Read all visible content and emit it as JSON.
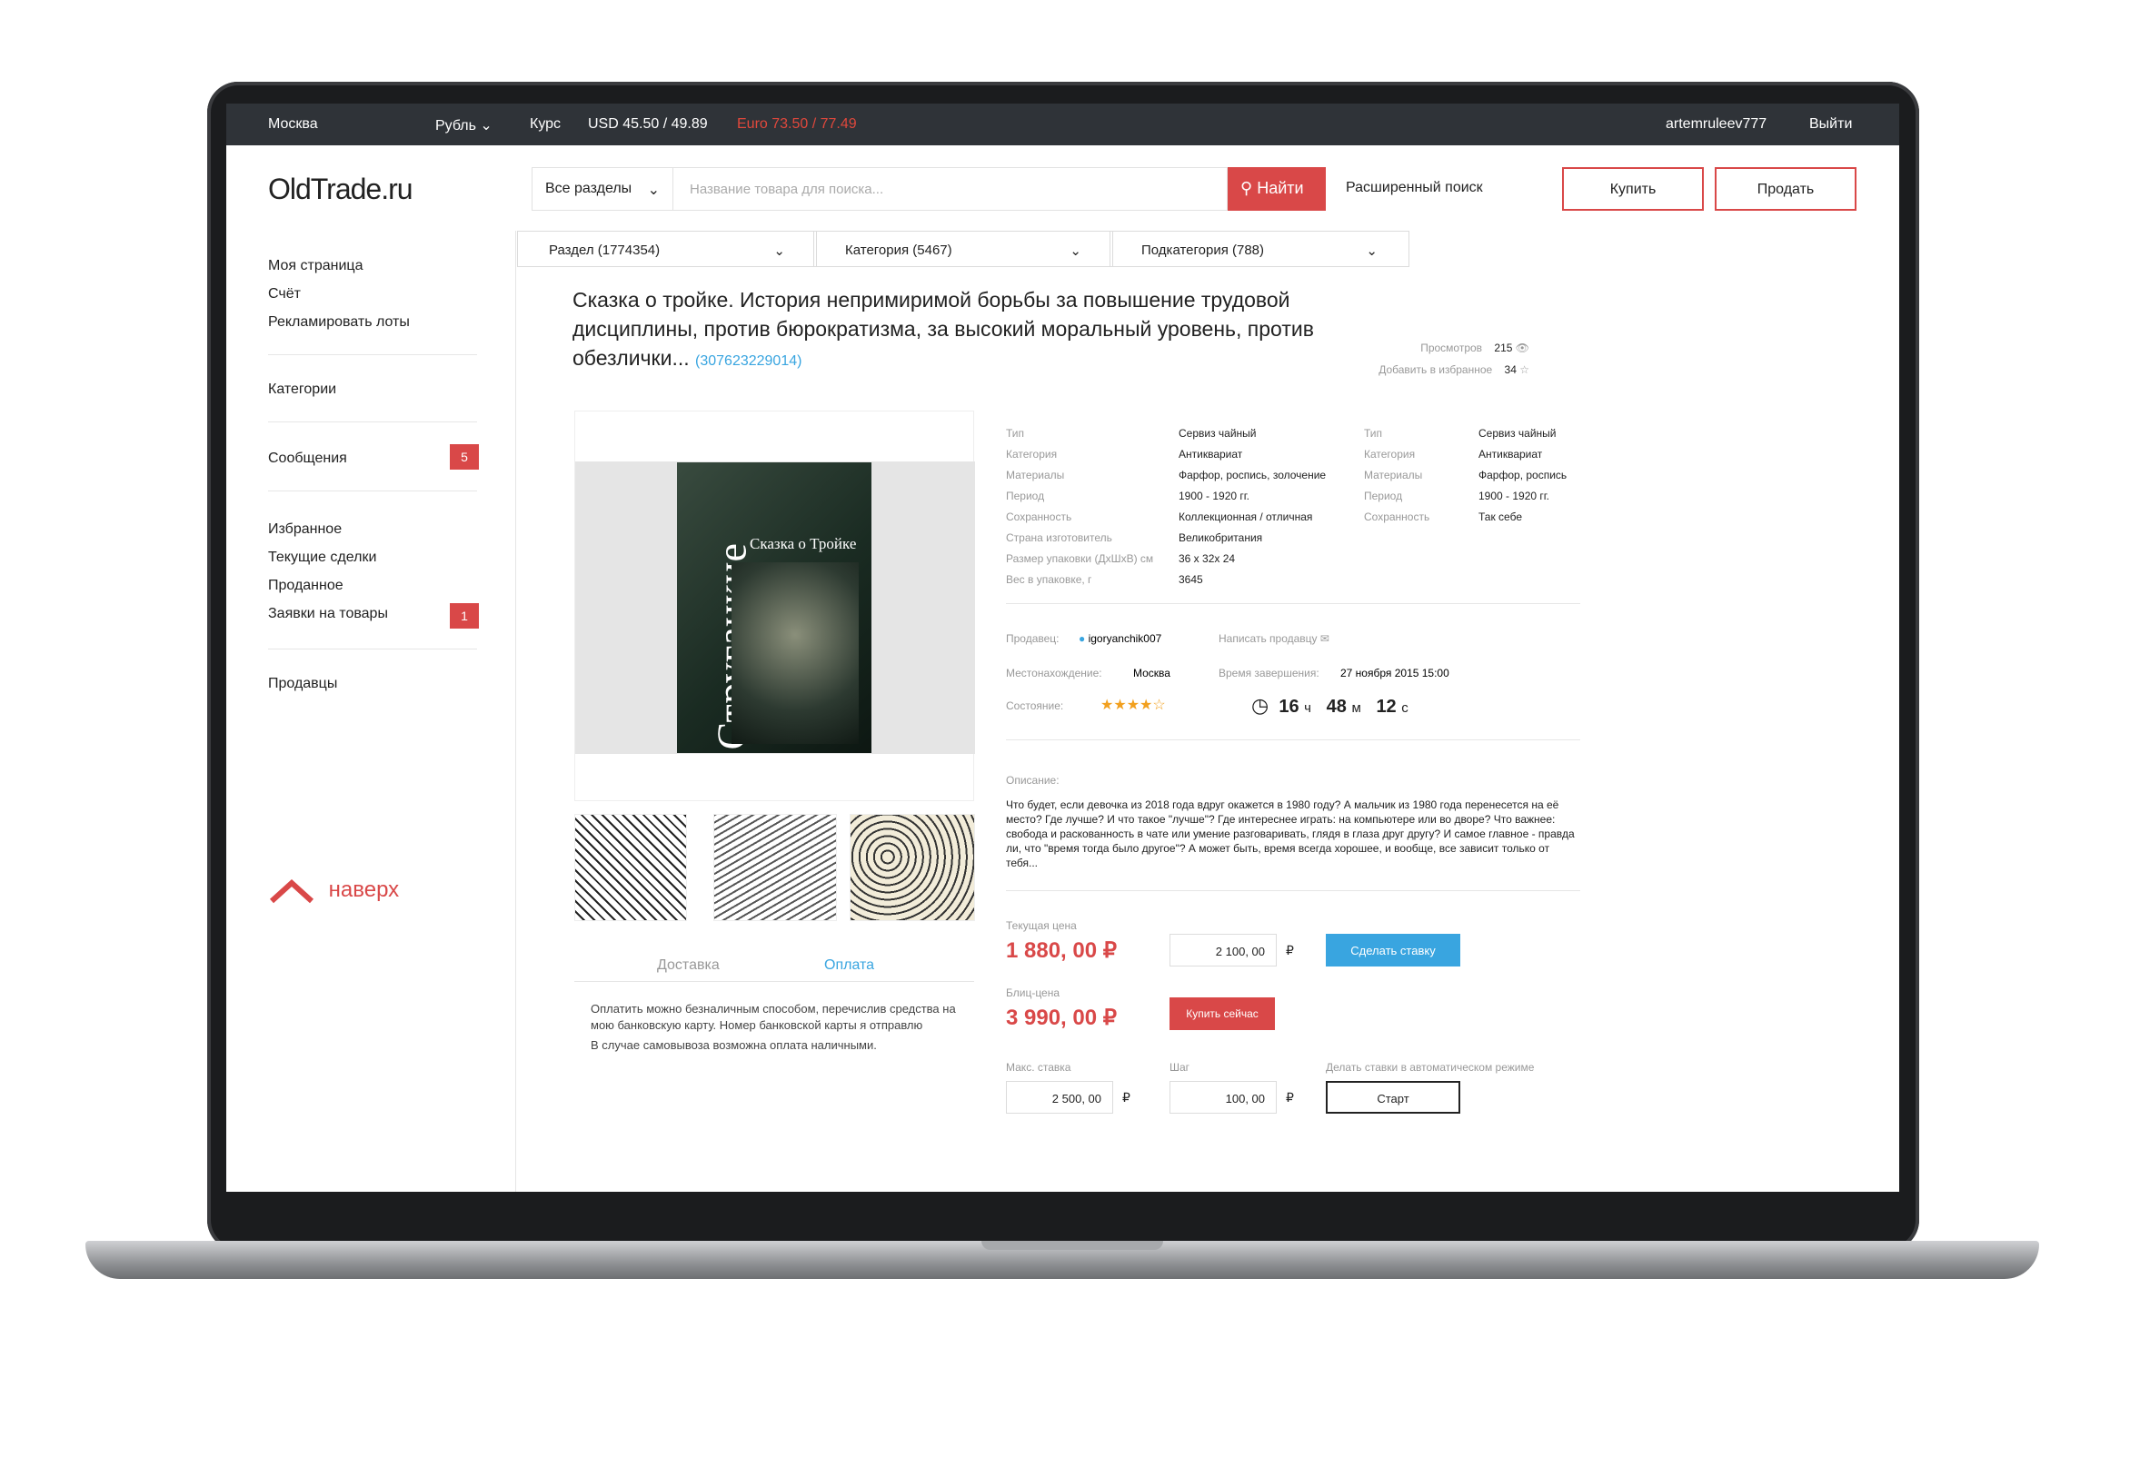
{
  "topbar": {
    "city": "Москва",
    "currency": "Рубль",
    "rate_label": "Курс",
    "usd": "USD 45.50 / 49.89",
    "euro": "Euro 73.50 / 77.49",
    "user": "artemruleev777",
    "logout": "Выйти"
  },
  "header": {
    "logo": "OldTrade.ru",
    "section_select": "Все разделы",
    "search_placeholder": "Название товара для поиска...",
    "search_button": "Найти",
    "advanced": "Расширенный поиск",
    "buy": "Купить",
    "sell": "Продать"
  },
  "sidebar": {
    "items1": [
      "Моя страница",
      "Счёт",
      "Рекламировать лоты"
    ],
    "categories": "Категории",
    "messages": "Сообщения",
    "messages_badge": "5",
    "items2": [
      "Избранное",
      "Текущие сделки",
      "Проданное",
      "Заявки на товары"
    ],
    "requests_badge": "1",
    "sellers": "Продавцы",
    "up": "наверх"
  },
  "crumbs": [
    "Раздел (1774354)",
    "Категория (5467)",
    "Подкатегория (788)"
  ],
  "lot": {
    "title": "Сказка о тройке. История непримиримой борьбы за повышение трудовой дисциплины, против бюрократизма, за высокий моральный уровень, против обезлички...",
    "id": "(307623229014)",
    "views_label": "Просмотров",
    "views": "215",
    "fav_label": "Добавить в избранное",
    "fav": "34",
    "book_author": "Стругацкие",
    "book_title": "Сказка о Тройке"
  },
  "specs1": [
    [
      "Тип",
      "Сервиз чайный"
    ],
    [
      "Категория",
      "Антиквариат"
    ],
    [
      "Материалы",
      "Фарфор, роспись, золочение"
    ],
    [
      "Период",
      "1900 - 1920 гг."
    ],
    [
      "Сохранность",
      "Коллекционная / отличная"
    ],
    [
      "Страна изготовитель",
      "Великобритания"
    ],
    [
      "Размер упаковки (ДхШхВ) см",
      "36 x 32x 24"
    ],
    [
      "Вес в упаковке, г",
      "3645"
    ]
  ],
  "specs2": [
    [
      "Тип",
      "Сервиз чайный"
    ],
    [
      "Категория",
      "Антиквариат"
    ],
    [
      "Материалы",
      "Фарфор, роспись"
    ],
    [
      "Период",
      "1900 - 1920 гг."
    ],
    [
      "Сохранность",
      "Так себе"
    ]
  ],
  "seller": {
    "seller_label": "Продавец:",
    "seller": "igoryanchik007",
    "write_label": "Написать продавцу",
    "location_label": "Местонахождение:",
    "location": "Москва",
    "end_label": "Время завершения:",
    "end": "27 ноября 2015 15:00",
    "condition_label": "Состояние:",
    "stars": "★★★★☆",
    "rating": 3.5,
    "timer_h": "16",
    "timer_h_u": "ч",
    "timer_m": "48",
    "timer_m_u": "м",
    "timer_s": "12",
    "timer_s_u": "с"
  },
  "description": {
    "label": "Описание:",
    "text": "Что будет, если девочка из 2018 года вдруг окажется в 1980 году? А мальчик из 1980 года перенесется на её место? Где лучше? И что такое \"лучше\"? Где интереснее играть: на компьютере или во дворе? Что важнее: свобода и раскованность в чате или умение разговаривать, глядя в глаза друг другу? И самое главное - правда ли, что \"время тогда было другое\"? А может быть, время всегда хорошее, и вообще, все зависит только от тебя..."
  },
  "tabs": {
    "delivery": "Доставка",
    "payment": "Оплата",
    "text1": "Оплатить можно безналичным способом, перечислив средства на мою банковскую карту. Номер банковской карты я отправлю",
    "text2": "В случае самовывоза возможна оплата наличными."
  },
  "pricing": {
    "current_label": "Текущая цена",
    "current": "1 880, 00 ₽",
    "bid_value": "2 100, 00",
    "currency": "₽",
    "bid_button": "Сделать ставку",
    "blitz_label": "Блиц-цена",
    "blitz": "3 990, 00 ₽",
    "buy_now": "Купить сейчас",
    "max_label": "Макс. ставка",
    "max_value": "2 500, 00",
    "step_label": "Шаг",
    "step_value": "100, 00",
    "auto_label": "Делать ставки в автоматическом режиме",
    "start": "Старт"
  },
  "colors": {
    "accent": "#d94848",
    "link": "#39a5e0",
    "topbar": "#2f3338"
  }
}
